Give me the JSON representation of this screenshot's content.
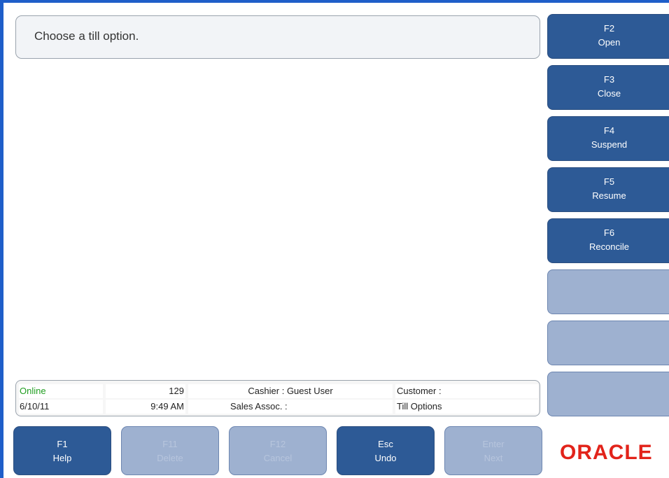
{
  "prompt": {
    "text": "Choose a till option."
  },
  "side_buttons": [
    {
      "key": "F2",
      "label": "Open",
      "enabled": true
    },
    {
      "key": "F3",
      "label": "Close",
      "enabled": true
    },
    {
      "key": "F4",
      "label": "Suspend",
      "enabled": true
    },
    {
      "key": "F5",
      "label": "Resume",
      "enabled": true
    },
    {
      "key": "F6",
      "label": "Reconcile",
      "enabled": true
    },
    {
      "key": "",
      "label": "",
      "enabled": false
    },
    {
      "key": "",
      "label": "",
      "enabled": false
    },
    {
      "key": "",
      "label": "",
      "enabled": false
    }
  ],
  "status": {
    "online": "Online",
    "register": "129",
    "cashier": "Cashier : Guest User",
    "customer": "Customer :",
    "date": "6/10/11",
    "time": "9:49 AM",
    "sales_assoc": "Sales Assoc. :",
    "screen": "Till Options"
  },
  "bottom_buttons": [
    {
      "key": "F1",
      "label": "Help",
      "enabled": true
    },
    {
      "key": "F11",
      "label": "Delete",
      "enabled": false
    },
    {
      "key": "F12",
      "label": "Cancel",
      "enabled": false
    },
    {
      "key": "Esc",
      "label": "Undo",
      "enabled": true
    },
    {
      "key": "Enter",
      "label": "Next",
      "enabled": false
    }
  ],
  "logo": {
    "text": "ORACLE"
  },
  "colors": {
    "button_active": "#2d5a96",
    "button_disabled": "#9eb1d0",
    "online_status": "#1f9d1f",
    "logo": "#e2231a",
    "edge": "#1f5ec9"
  }
}
